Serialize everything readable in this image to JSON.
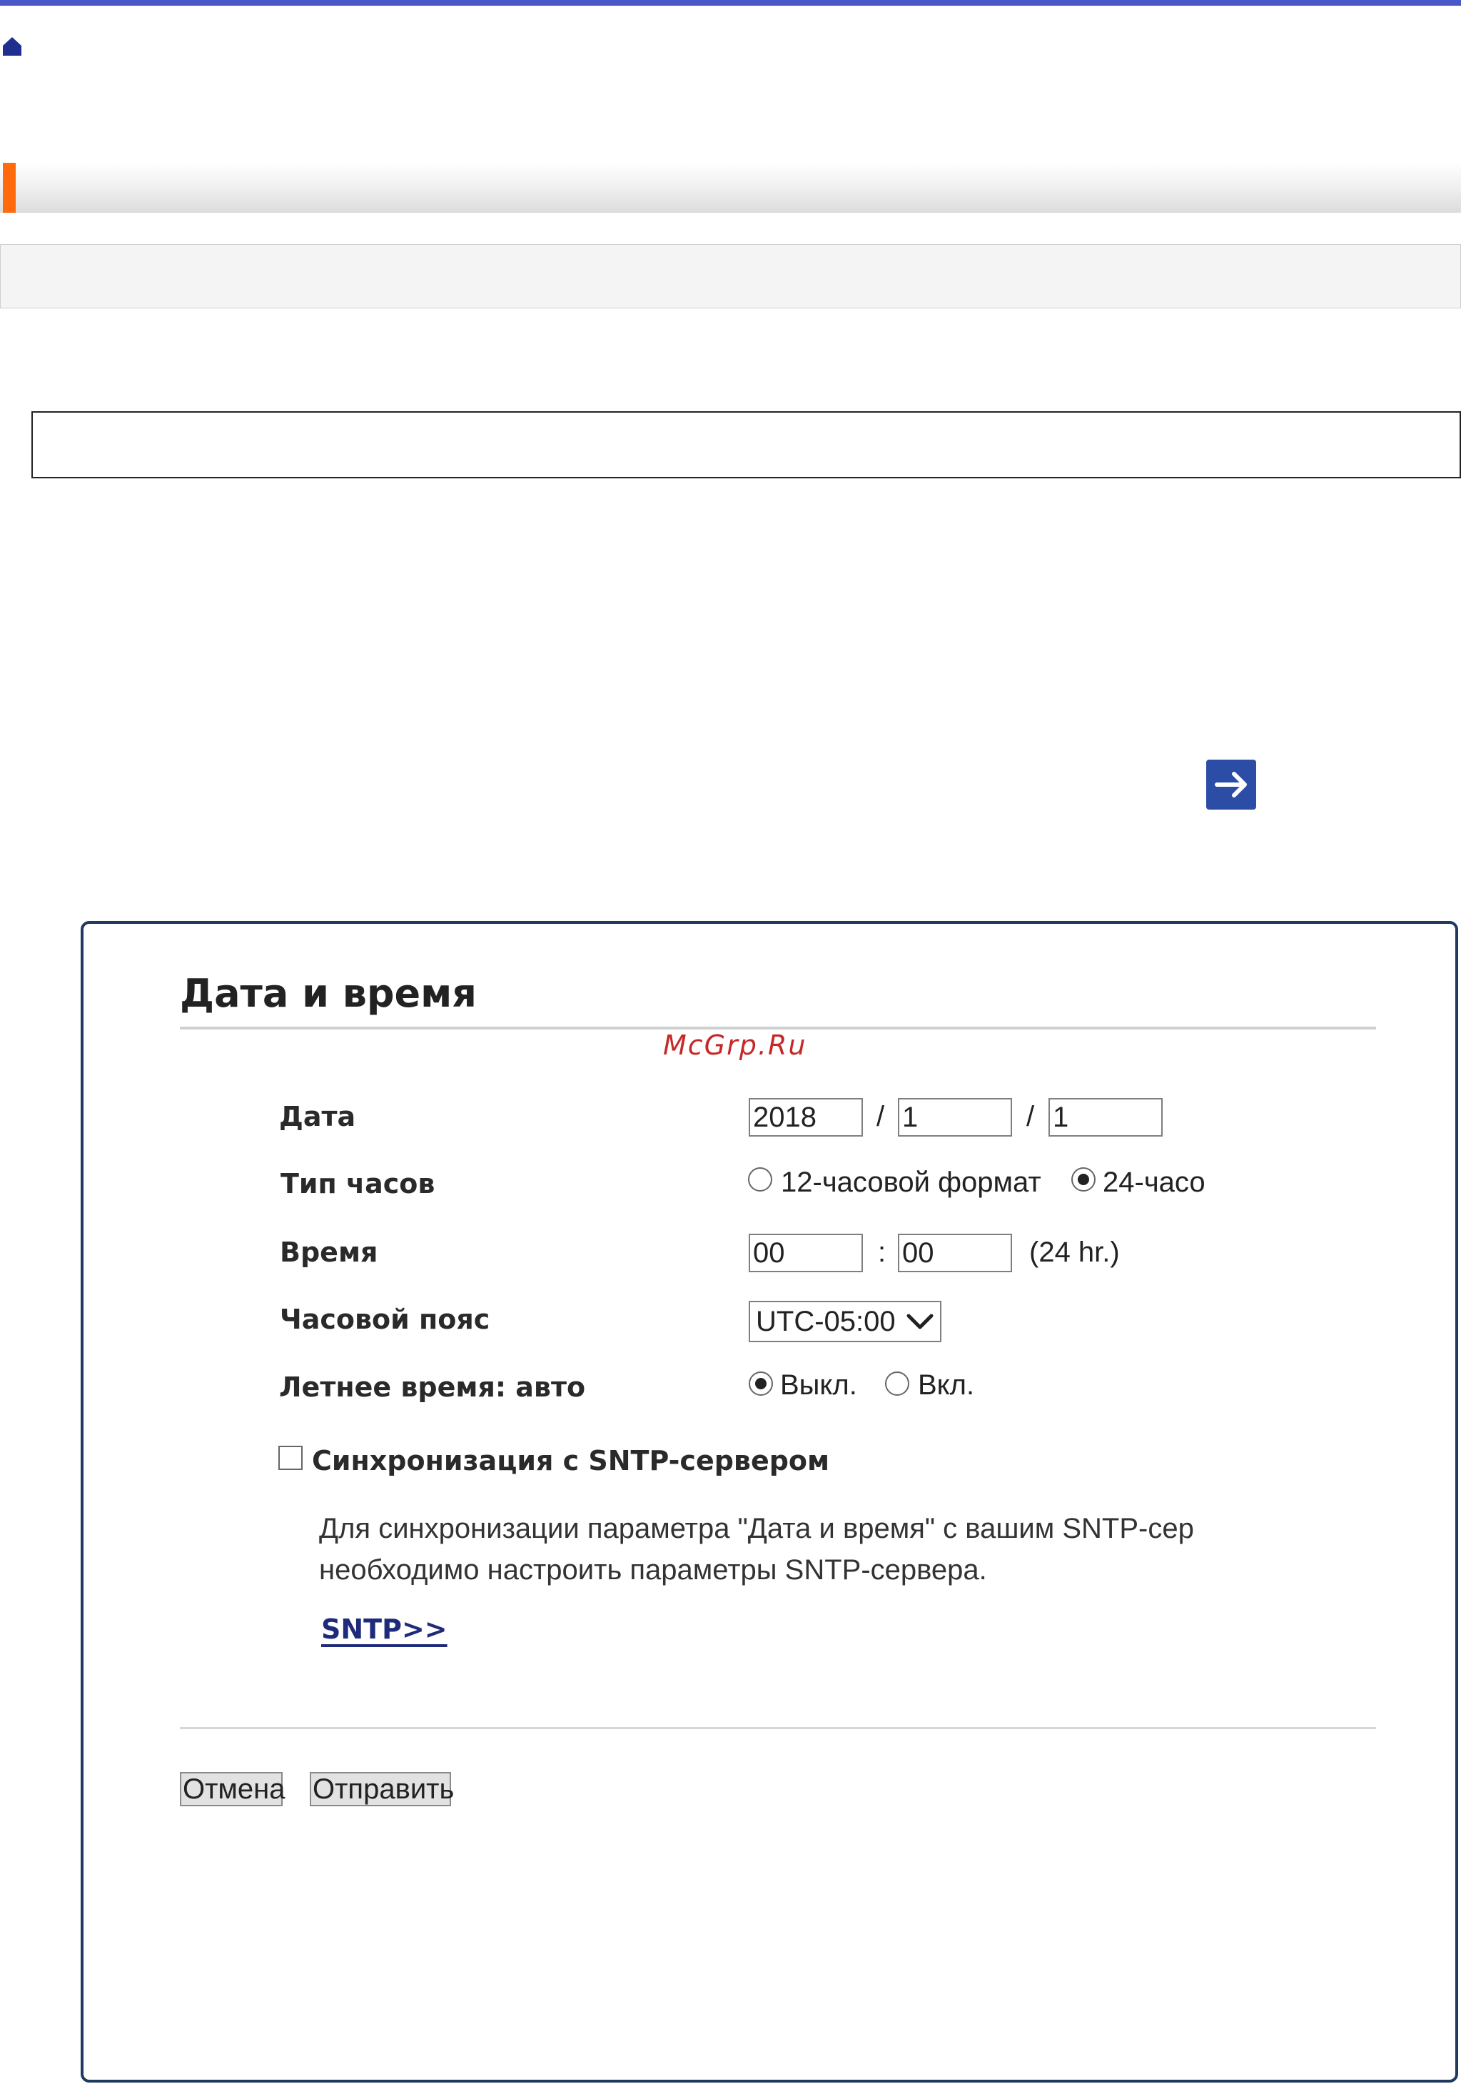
{
  "icons": {
    "home": "home-icon",
    "next": "arrow-right-icon"
  },
  "colors": {
    "top_rule": "#4a58c8",
    "accent": "#ff6a0d",
    "arrow_button": "#2b4da6"
  },
  "panel": {
    "title": "Дата и время",
    "watermark": "McGrp.Ru",
    "fields": {
      "date": {
        "label": "Дата",
        "year": "2018",
        "month": "1",
        "day": "1",
        "separator": "/"
      },
      "clock_type": {
        "label": "Тип часов",
        "option_12": "12-часовой формат",
        "option_24": "24-часо",
        "selected": "24"
      },
      "time": {
        "label": "Время",
        "hour": "00",
        "minute": "00",
        "separator": ":",
        "suffix": "(24 hr.)"
      },
      "timezone": {
        "label": "Часовой пояс",
        "value": "UTC-05:00"
      },
      "dst": {
        "label": "Летнее время: авто",
        "option_off": "Выкл.",
        "option_on": "Вкл.",
        "selected": "off"
      }
    },
    "sntp": {
      "checkbox_label": "Синхронизация с SNTP-сервером",
      "note_line1": "Для синхронизации параметра \"Дата и время\" с вашим SNTP-сер",
      "note_line2": "необходимо настроить параметры SNTP-сервера.",
      "link": "SNTP>>"
    },
    "buttons": {
      "cancel": "Отмена",
      "submit": "Отправить"
    }
  }
}
